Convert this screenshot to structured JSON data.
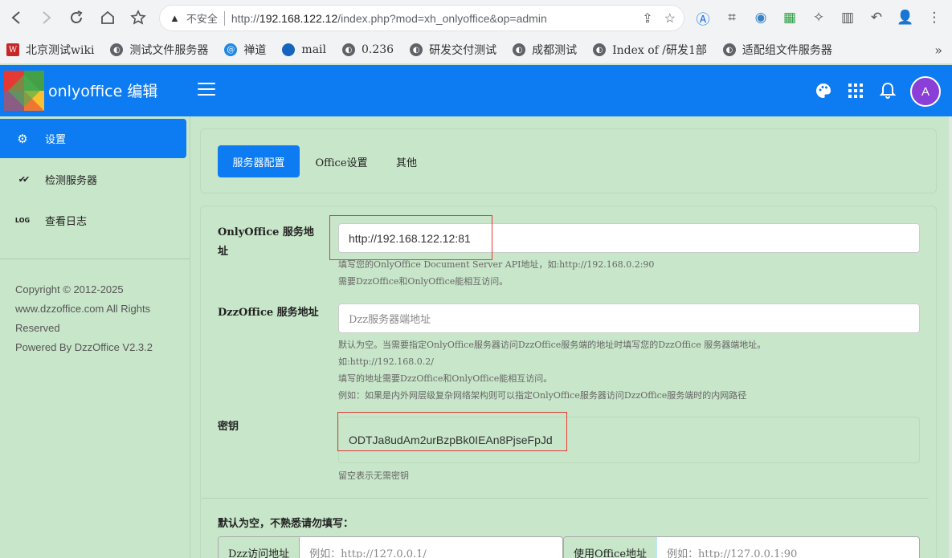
{
  "browser": {
    "insecure_label": "不安全",
    "url_prefix": "http://",
    "url_host": "192.168.122.12",
    "url_rest": "/index.php?mod=xh_onlyoffice&op=admin",
    "bookmarks": [
      {
        "label": "北京测试wiki",
        "icon": "wiki-icon"
      },
      {
        "label": "测试文件服务器",
        "icon": "globe-icon"
      },
      {
        "label": "禅道",
        "icon": "zentao-icon"
      },
      {
        "label": "mail",
        "icon": "mail-icon"
      },
      {
        "label": "0.236",
        "icon": "globe-icon"
      },
      {
        "label": "研发交付测试",
        "icon": "globe-icon"
      },
      {
        "label": "成都测试",
        "icon": "globe-icon"
      },
      {
        "label": "Index of /研发1部",
        "icon": "globe-icon"
      },
      {
        "label": "适配组文件服务器",
        "icon": "globe-icon"
      }
    ],
    "more_label": "»"
  },
  "header": {
    "title": "onlyoffice 编辑",
    "avatar_letter": "A",
    "colors": {
      "primary": "#0d7cf2",
      "avatar": "#8b3fd9"
    }
  },
  "sidebar": {
    "items": [
      {
        "label": "设置",
        "icon": "gear-icon",
        "glyph": "⚙"
      },
      {
        "label": "检测服务器",
        "icon": "check-double-icon",
        "glyph": "✔✔"
      },
      {
        "label": "查看日志",
        "icon": "log-icon",
        "glyph": "LOG"
      }
    ],
    "copyright_lines": [
      "Copyright © 2012-2025",
      "www.dzzoffice.com All Rights",
      "Reserved",
      "Powered By DzzOffice V2.3.2"
    ]
  },
  "tabs": [
    {
      "label": "服务器配置",
      "active": true
    },
    {
      "label": "Office设置",
      "active": false
    },
    {
      "label": "其他",
      "active": false
    }
  ],
  "form": {
    "onlyoffice_url": {
      "label": "OnlyOffice 服务地址",
      "value": "http://192.168.122.12:81",
      "help": [
        "填写您的OnlyOffice Document Server API地址，如:http://192.168.0.2:90",
        "需要DzzOffice和OnlyOffice能相互访问。"
      ]
    },
    "dzzoffice_url": {
      "label": "DzzOffice 服务地址",
      "placeholder": "Dzz服务器端地址",
      "help": [
        "默认为空。当需要指定OnlyOffice服务器访问DzzOffice服务端的地址时填写您的DzzOffice 服务器端地址。",
        "如:http://192.168.0.2/",
        "填写的地址需要DzzOffice和OnlyOffice能相互访问。",
        "例如：如果是内外网层级复杂网络架构则可以指定OnlyOffice服务器访问DzzOffice服务端时的内网路径"
      ]
    },
    "secret": {
      "label": "密钥",
      "value": "ODTJa8udAm2urBzpBk0IEAn8PjseFpJd",
      "help": "留空表示无需密钥"
    },
    "advanced_title": "默认为空，不熟悉请勿填写：",
    "dzz_access": {
      "label": "Dzz访问地址",
      "placeholder": "例如：http://127.0.0.1/"
    },
    "office_use": {
      "label": "使用Office地址",
      "placeholder": "例如：http://127.0.0.1:90"
    }
  }
}
